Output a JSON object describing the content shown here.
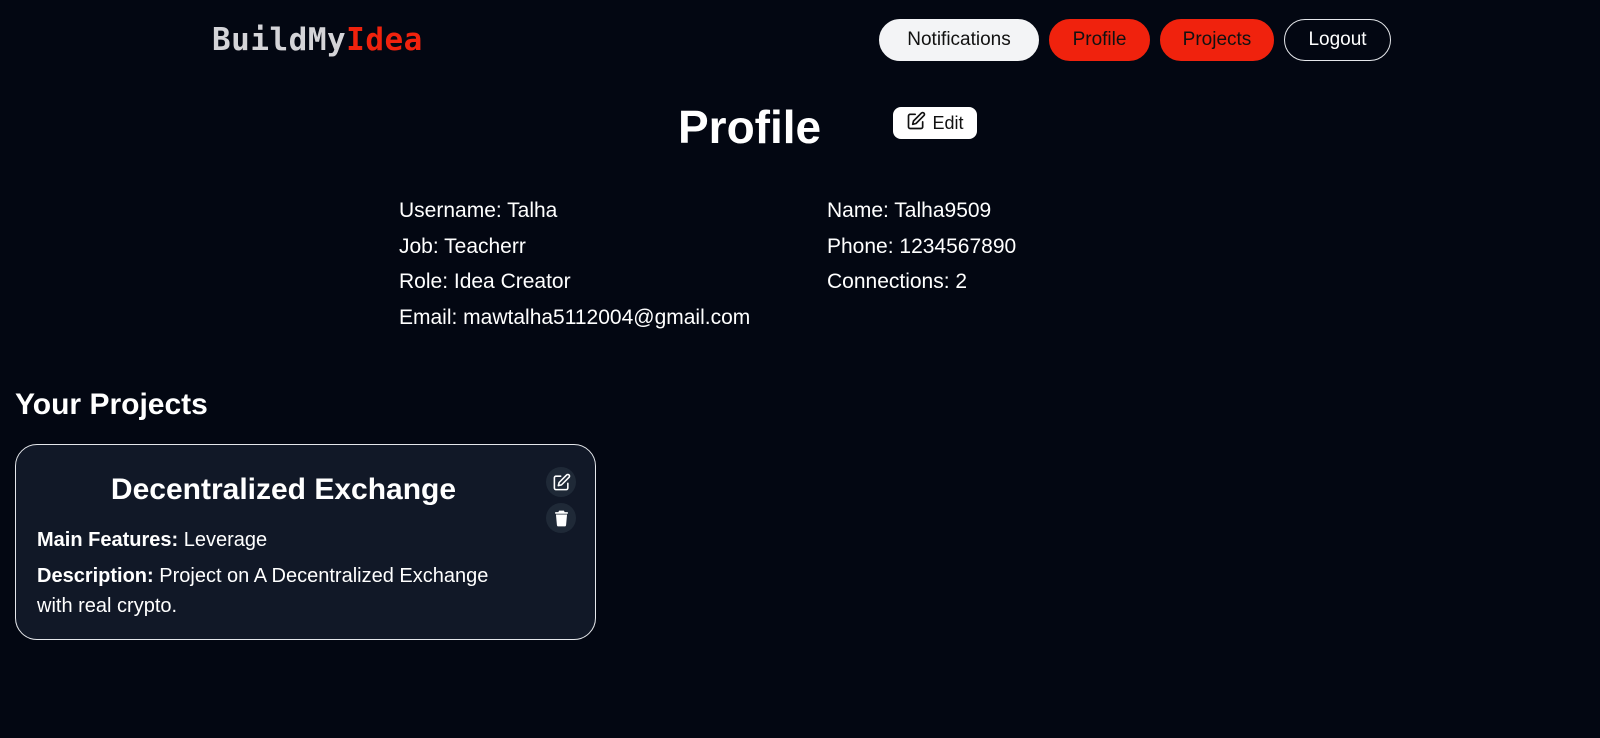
{
  "header": {
    "logo_part1": "BuildMy",
    "logo_part2": "Idea",
    "nav": {
      "notifications": "Notifications",
      "profile": "Profile",
      "projects": "Projects",
      "logout": "Logout"
    }
  },
  "profile": {
    "title": "Profile",
    "edit_label": "Edit",
    "username": "Username: Talha",
    "job": "Job: Teacherr",
    "role": "Role: Idea Creator",
    "email": "Email: mawtalha5112004@gmail.com",
    "name": "Name: Talha9509",
    "phone": "Phone: 1234567890",
    "connections": "Connections: 2"
  },
  "projects": {
    "heading": "Your Projects",
    "items": [
      {
        "title": "Decentralized Exchange",
        "features_label": "Main Features:",
        "features": "Leverage",
        "description_label": "Description:",
        "description": "Project on A Decentralized Exchange with real crypto."
      }
    ]
  },
  "colors": {
    "background": "#030712",
    "accent": "#f0220d",
    "card_background": "#111827",
    "logo_gray": "#d4d4d8"
  },
  "icons": {
    "edit": "edit-icon",
    "card_edit": "edit-icon",
    "card_delete": "trash-icon"
  }
}
